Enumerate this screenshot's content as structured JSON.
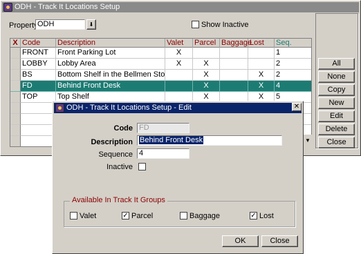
{
  "main_window": {
    "title": "ODH - Track It Locations Setup",
    "property_label": "Property",
    "property_value": "ODH",
    "show_inactive_label": "Show Inactive",
    "show_inactive_checked": "",
    "columns": [
      "X",
      "Code",
      "Description",
      "Valet",
      "Parcel",
      "Baggage",
      "Lost",
      "Seq."
    ],
    "rows": [
      {
        "code": "FRONT",
        "description": "Front Parking Lot",
        "valet": "X",
        "parcel": "",
        "baggage": "",
        "lost": "",
        "seq": "1"
      },
      {
        "code": "LOBBY",
        "description": "Lobby Area",
        "valet": "X",
        "parcel": "X",
        "baggage": "",
        "lost": "",
        "seq": "2"
      },
      {
        "code": "BS",
        "description": "Bottom Shelf in the Bellmen Storage C",
        "valet": "",
        "parcel": "X",
        "baggage": "",
        "lost": "X",
        "seq": "2"
      },
      {
        "code": "FD",
        "description": "Behind Front Desk",
        "valet": "",
        "parcel": "X",
        "baggage": "",
        "lost": "X",
        "seq": "4"
      },
      {
        "code": "TOP",
        "description": "Top Shelf",
        "valet": "",
        "parcel": "X",
        "baggage": "",
        "lost": "X",
        "seq": "5"
      }
    ],
    "buttons": {
      "all": "All",
      "none": "None",
      "copy": "Copy",
      "new": "New",
      "edit": "Edit",
      "delete": "Delete",
      "close": "Close"
    }
  },
  "edit_dialog": {
    "title": "ODH - Track It Locations Setup - Edit",
    "code_label": "Code",
    "code_value": "FD",
    "description_label": "Description",
    "description_value": "Behind Front Desk",
    "sequence_label": "Sequence",
    "sequence_value": "4",
    "inactive_label": "Inactive",
    "inactive_checked": "",
    "groups_title": "Available In Track It Groups",
    "groups": {
      "valet": {
        "label": "Valet",
        "checked": ""
      },
      "parcel": {
        "label": "Parcel",
        "checked": "✓"
      },
      "baggage": {
        "label": "Baggage",
        "checked": ""
      },
      "lost": {
        "label": "Lost",
        "checked": "✓"
      }
    },
    "ok_label": "OK",
    "close_label": "Close"
  },
  "colors": {
    "selected_row": "#1c7c74",
    "active_title": "#0a246a",
    "inactive_title": "#8a8a8a",
    "header_text": "#8b0000"
  },
  "icons": {
    "window_icon": "app-icon",
    "close": "close-icon",
    "dropdown": "dropdown-arrow-icon"
  }
}
